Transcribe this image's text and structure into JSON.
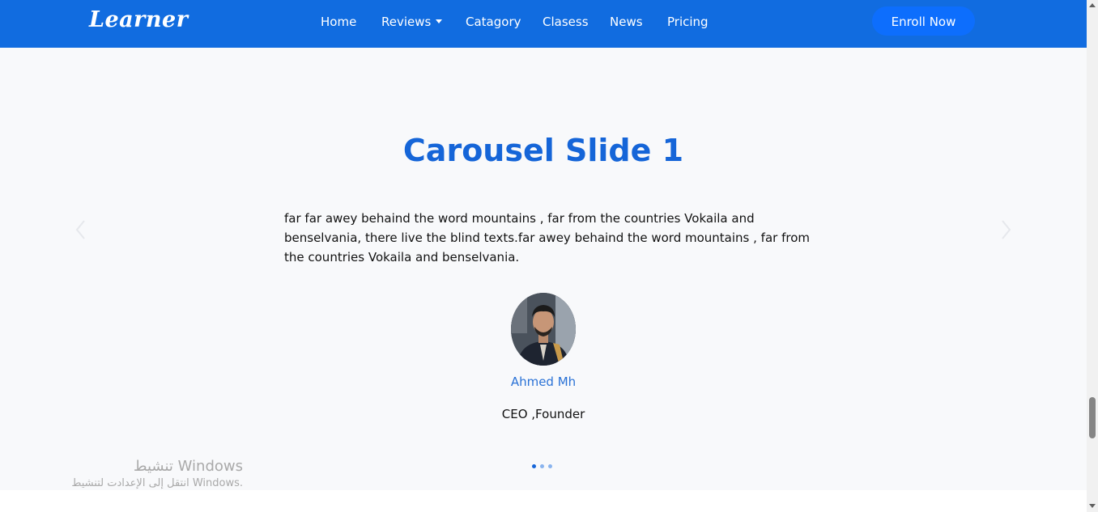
{
  "navbar": {
    "logo": "Learner",
    "links": [
      {
        "label": "Home"
      },
      {
        "label": "Reviews",
        "has_dropdown": true
      },
      {
        "label": "Catagory"
      },
      {
        "label": "Clasess"
      },
      {
        "label": "News"
      },
      {
        "label": "Pricing"
      }
    ],
    "cta_label": "Enroll Now"
  },
  "carousel": {
    "title": "Carousel Slide 1",
    "quote": "far far awey behaind the word mountains , far from the countries Vokaila and benselvania, there live the blind texts.far awey behaind the word mountains , far from the countries Vokaila and benselvania.",
    "person_name": "Ahmed Mh",
    "person_role": "CEO ,Founder",
    "prev_icon": "chevron-left-icon",
    "next_icon": "chevron-right-icon",
    "indicators": 3,
    "active_indicator": 1
  },
  "watermark": {
    "title": "تنشيط Windows",
    "subtitle": "انتقل إلى الإعدادت لتنشيط Windows."
  },
  "colors": {
    "navbar_bg": "#116ce0",
    "button_bg": "#0d6efd",
    "title": "#1565d8",
    "name": "#2a72d6",
    "content_bg": "#f8f9fb"
  }
}
